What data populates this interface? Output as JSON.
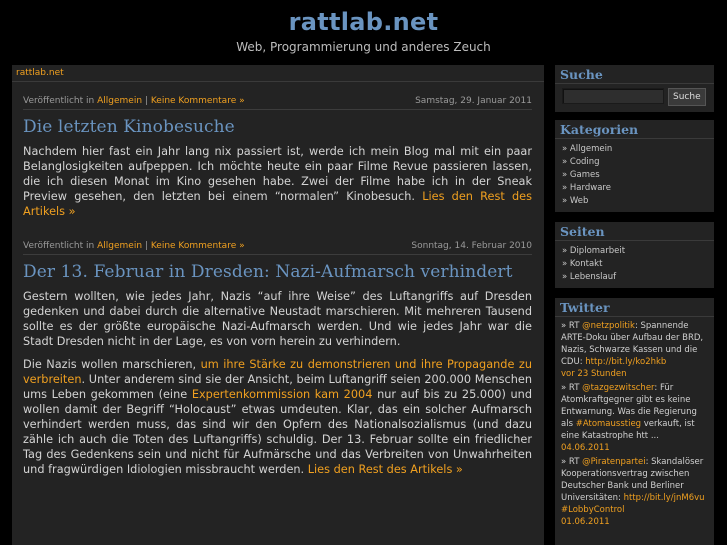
{
  "site": {
    "title": "rattlab.net",
    "tagline": "Web, Programmierung und anderes Zeuch"
  },
  "breadcrumb": "rattlab.net",
  "posts": [
    {
      "published_prefix": "Veröffentlicht in",
      "category": "Allgemein",
      "separator": "|",
      "comments": "Keine Kommentare »",
      "date": "Samstag, 29. Januar 2011",
      "title": "Die letzten Kinobesuche",
      "body": "Nachdem hier fast ein Jahr lang nix passiert ist, werde ich mein Blog mal mit ein paar Belanglosigkeiten aufpeppen. Ich möchte heute ein paar Filme Revue passieren lassen, die ich diesen Monat im Kino gesehen habe. Zwei der Filme habe ich in der Sneak Preview gesehen, den letzten bei einem “normalen” Kinobesuch.",
      "more": "Lies den Rest des Artikels »"
    },
    {
      "published_prefix": "Veröffentlicht in",
      "category": "Allgemein",
      "separator": "|",
      "comments": "Keine Kommentare »",
      "date": "Sonntag, 14. Februar 2010",
      "title": "Der 13. Februar in Dresden: Nazi-Aufmarsch verhindert",
      "body1": "Gestern wollten, wie jedes Jahr, Nazis “auf ihre Weise” des Luftangriffs auf Dresden gedenken und dabei durch die alternative Neustadt marschieren. Mit mehreren Tausend sollte es der größte europäische Nazi-Aufmarsch werden. Und wie jedes Jahr war die Stadt Dresden nicht in der Lage, es von vorn herein zu verhindern.",
      "body2_a": "Die Nazis wollen marschieren,",
      "body2_link1": "um ihre Stärke zu demonstrieren und ihre Propagande zu verbreiten",
      "body2_b": ". Unter anderem sind sie der Ansicht, beim Luftangriff seien 200.000 Menschen ums Leben gekommen (eine",
      "body2_link2": "Expertenkommission kam 2004",
      "body2_c": "nur auf bis zu 25.000) und wollen damit der Begriff “Holocaust” etwas umdeuten. Klar, das ein solcher Aufmarsch verhindert werden muss, das sind wir den Opfern des Nationalsozialismus (und dazu zähle ich auch die Toten des Luftangriffs) schuldig. Der 13. Februar sollte ein friedlicher Tag des Gedenkens sein und nicht für Aufmärsche und das Verbreiten von Unwahrheiten und fragwürdigen Idiologien missbraucht werden.",
      "more": "Lies den Rest des Artikels »"
    }
  ],
  "sidebar": {
    "search": {
      "title": "Suche",
      "button": "Suche",
      "value": ""
    },
    "categories": {
      "title": "Kategorien",
      "items": [
        "» Allgemein",
        "» Coding",
        "» Games",
        "» Hardware",
        "» Web"
      ]
    },
    "pages": {
      "title": "Seiten",
      "items": [
        "» Diplomarbeit",
        "» Kontakt",
        "» Lebenslauf"
      ]
    },
    "twitter": {
      "title": "Twitter",
      "tweets": [
        {
          "rt": "» RT",
          "user": "@netzpolitik",
          "text": ": Spannende ARTE-Doku über Aufbau der BRD, Nazis, Schwarze Kassen und die CDU:",
          "link": "http://bit.ly/ko2hkb",
          "time": "vor 23 Stunden"
        },
        {
          "rt": "» RT",
          "user": "@tazgezwitscher",
          "text": ": Für Atomkraftgegner gibt es keine Entwarnung. Was die Regierung als",
          "tag": "#Atomausstieg",
          "text2": "verkauft, ist eine Katastrophe htt ...",
          "time": "04.06.2011"
        },
        {
          "rt": "» RT",
          "user": "@Piratenpartei",
          "text": ": Skandalöser Kooperationsvertrag zwischen Deutscher Bank und Berliner Universitäten:",
          "link": "http://bit.ly/jnM6vu",
          "tag": "#LobbyControl",
          "time": "01.06.2011"
        }
      ]
    }
  }
}
